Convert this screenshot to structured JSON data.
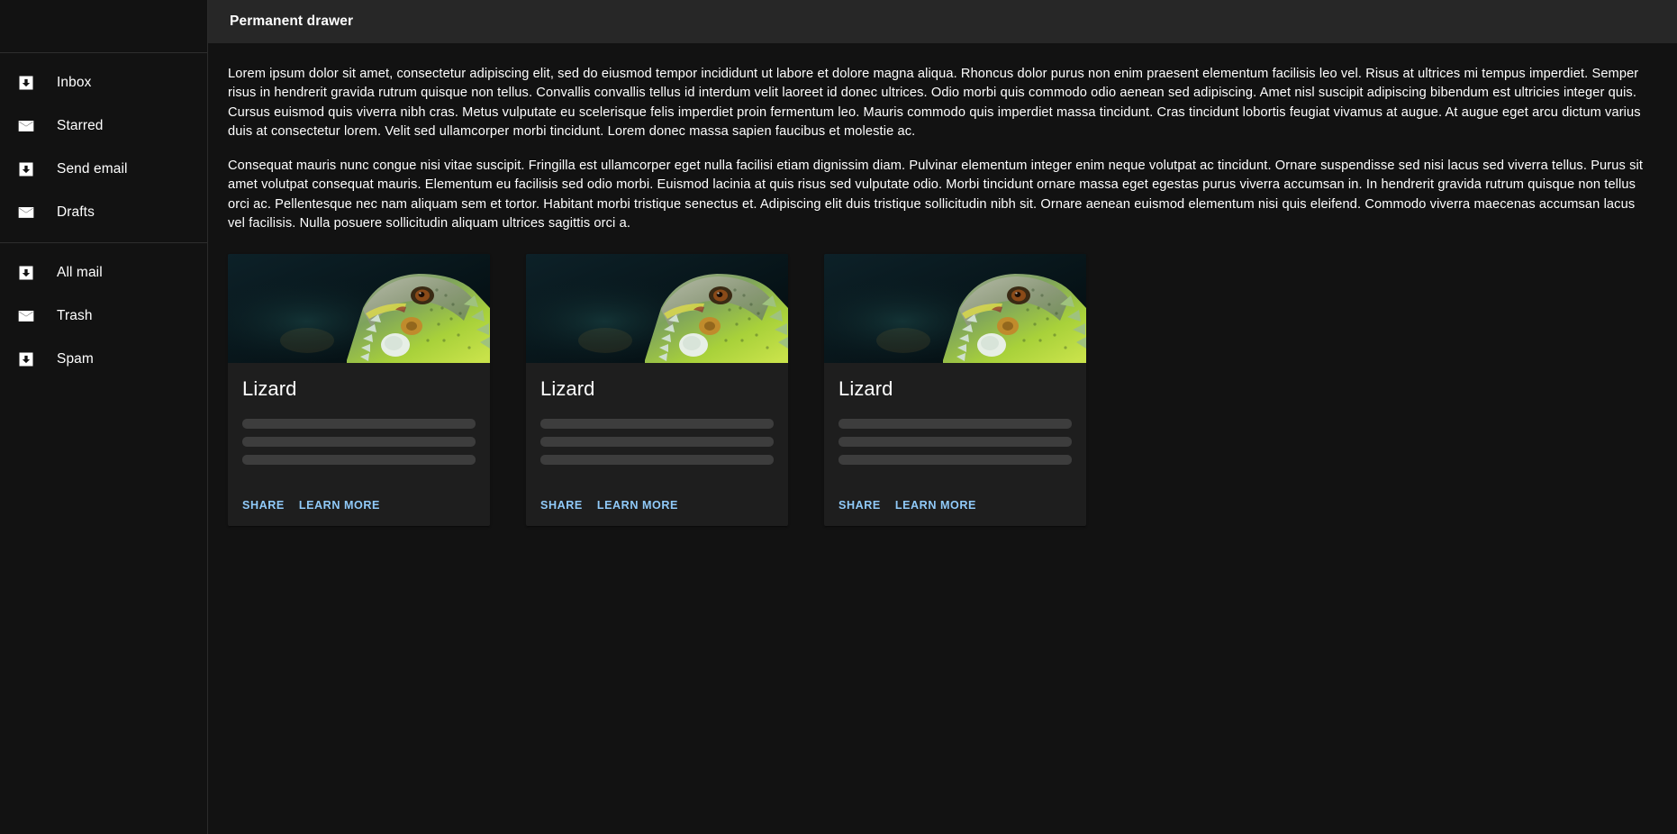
{
  "app": {
    "title": "Permanent drawer",
    "accent_blue": "#90caf9",
    "background": "#121212",
    "appbar_background": "#272727",
    "card_background": "#1e1e1e",
    "skeleton_color": "#3d3d3d"
  },
  "drawer": {
    "groups": [
      {
        "items": [
          {
            "label": "Inbox",
            "icon": "inbox-icon"
          },
          {
            "label": "Starred",
            "icon": "mail-icon"
          },
          {
            "label": "Send email",
            "icon": "inbox-icon"
          },
          {
            "label": "Drafts",
            "icon": "mail-icon"
          }
        ]
      },
      {
        "items": [
          {
            "label": "All mail",
            "icon": "inbox-icon"
          },
          {
            "label": "Trash",
            "icon": "mail-icon"
          },
          {
            "label": "Spam",
            "icon": "inbox-icon"
          }
        ]
      }
    ]
  },
  "content": {
    "paragraphs": [
      "Lorem ipsum dolor sit amet, consectetur adipiscing elit, sed do eiusmod tempor incididunt ut labore et dolore magna aliqua. Rhoncus dolor purus non enim praesent elementum facilisis leo vel. Risus at ultrices mi tempus imperdiet. Semper risus in hendrerit gravida rutrum quisque non tellus. Convallis convallis tellus id interdum velit laoreet id donec ultrices. Odio morbi quis commodo odio aenean sed adipiscing. Amet nisl suscipit adipiscing bibendum est ultricies integer quis. Cursus euismod quis viverra nibh cras. Metus vulputate eu scelerisque felis imperdiet proin fermentum leo. Mauris commodo quis imperdiet massa tincidunt. Cras tincidunt lobortis feugiat vivamus at augue. At augue eget arcu dictum varius duis at consectetur lorem. Velit sed ullamcorper morbi tincidunt. Lorem donec massa sapien faucibus et molestie ac.",
      "Consequat mauris nunc congue nisi vitae suscipit. Fringilla est ullamcorper eget nulla facilisi etiam dignissim diam. Pulvinar elementum integer enim neque volutpat ac tincidunt. Ornare suspendisse sed nisi lacus sed viverra tellus. Purus sit amet volutpat consequat mauris. Elementum eu facilisis sed odio morbi. Euismod lacinia at quis risus sed vulputate odio. Morbi tincidunt ornare massa eget egestas purus viverra accumsan in. In hendrerit gravida rutrum quisque non tellus orci ac. Pellentesque nec nam aliquam sem et tortor. Habitant morbi tristique senectus et. Adipiscing elit duis tristique sollicitudin nibh sit. Ornare aenean euismod elementum nisi quis eleifend. Commodo viverra maecenas accumsan lacus vel facilisis. Nulla posuere sollicitudin aliquam ultrices sagittis orci a."
    ]
  },
  "cards": [
    {
      "title": "Lizard",
      "media_alt": "green-iguana-photo",
      "skeleton_lines": 3,
      "actions": {
        "share": "Share",
        "learn_more": "Learn More"
      }
    },
    {
      "title": "Lizard",
      "media_alt": "green-iguana-photo",
      "skeleton_lines": 3,
      "actions": {
        "share": "Share",
        "learn_more": "Learn More"
      }
    },
    {
      "title": "Lizard",
      "media_alt": "green-iguana-photo",
      "skeleton_lines": 3,
      "actions": {
        "share": "Share",
        "learn_more": "Learn More"
      }
    }
  ]
}
